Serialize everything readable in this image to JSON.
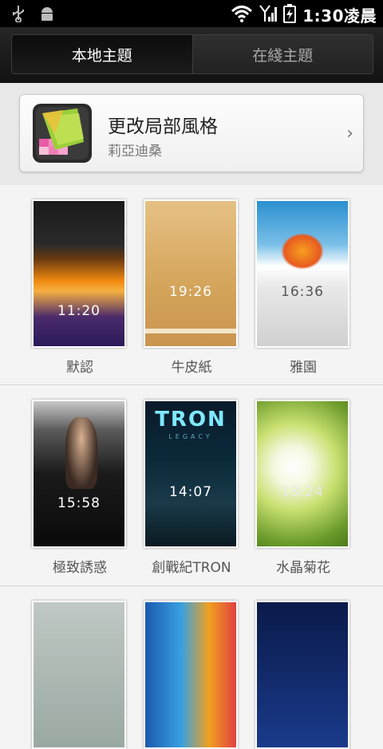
{
  "status_bar": {
    "time": "1:30凌晨",
    "icons": [
      "usb-icon",
      "android-debug-icon",
      "wifi-icon",
      "signal-icon",
      "battery-charging-icon"
    ]
  },
  "tabs": [
    {
      "label": "本地主題",
      "active": true
    },
    {
      "label": "在綫主題",
      "active": false
    }
  ],
  "banner": {
    "title": "更改局部風格",
    "subtitle": "莉亞迪桑",
    "chevron": "›"
  },
  "themes": [
    {
      "name": "默認",
      "clock": "11:20"
    },
    {
      "name": "牛皮紙",
      "clock": "19:26"
    },
    {
      "name": "雅園",
      "clock": "16:36"
    },
    {
      "name": "極致誘惑",
      "clock": "15:58"
    },
    {
      "name": "創戰紀TRON",
      "clock": "14:07",
      "logo": "TRON",
      "logo_sub": "LEGACY"
    },
    {
      "name": "水晶菊花",
      "clock": "13:24"
    }
  ],
  "colors": {
    "status_bg": "#000000",
    "tab_active_text": "#ffffff",
    "tab_inactive_text": "#a8a8a8",
    "label_text": "#555555"
  }
}
